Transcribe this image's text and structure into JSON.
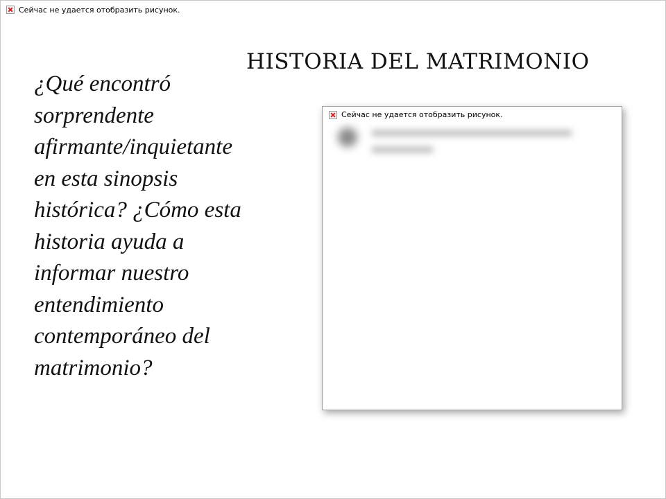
{
  "slide": {
    "title": "HISTORIA DEL MATRIMONIO",
    "body_lines": [
      "¿Qué encontró",
      "sorprendente",
      "afirmante/inquietante",
      "en esta sinopsis",
      "histórica? ¿Cómo esta",
      "historia ayuda a",
      "informar nuestro",
      "entendimiento",
      "contemporáneo del",
      "matrimonio?"
    ]
  },
  "placeholders": {
    "top": {
      "icon": "broken-image-icon",
      "caption": "Сейчас не удается отобразить рисунок."
    },
    "right": {
      "icon": "broken-image-icon",
      "caption": "Сейчас не удается отобразить рисунок."
    }
  }
}
